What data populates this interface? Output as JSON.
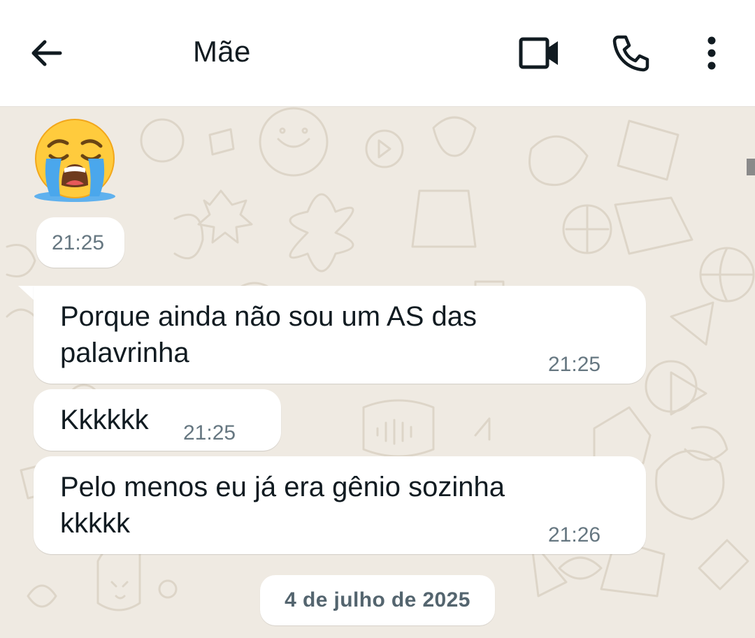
{
  "header": {
    "contact_name": "Mãe",
    "icons": {
      "back": "arrow-left-icon",
      "video": "video-camera-icon",
      "call": "phone-icon",
      "menu": "more-vertical-icon"
    }
  },
  "chat": {
    "background_color": "#efeae2",
    "bubble_color": "#ffffff",
    "emoji_message": {
      "emoji": "loudly-crying-face",
      "time": "21:25"
    },
    "messages": [
      {
        "text": "Porque ainda não sou um AS das\npalavrinha",
        "time": "21:25"
      },
      {
        "text": "Kkkkkk",
        "time": "21:25"
      },
      {
        "text": "Pelo menos eu já era gênio sozinha\nkkkkk",
        "time": "21:26"
      }
    ],
    "date_separator": "4 de julho de 2025"
  }
}
